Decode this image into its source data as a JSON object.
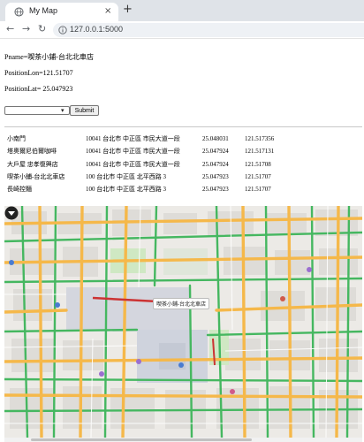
{
  "browser": {
    "tab_title": "My Map",
    "tab_close": "×",
    "new_tab": "+",
    "url": "127.0.0.1:5000",
    "nav": {
      "back": "←",
      "forward": "→",
      "reload": "↻"
    }
  },
  "info": {
    "pname": "Pname=喫茶小鋪-台北北車店",
    "lon": "PositionLon=121.51707",
    "lat": "PositionLat= 25.047923"
  },
  "form": {
    "select_value": "",
    "caret": "▾",
    "submit_label": "Submit"
  },
  "places": [
    {
      "name": "小南門",
      "address": "10041 台北市 中正區 市民大道一段",
      "lat": "25.048031",
      "lon": "121.517356"
    },
    {
      "name": "塔奧爾尼伯爾咖啡",
      "address": "10041 台北市 中正區 市民大道一段",
      "lat": "25.047924",
      "lon": "121.517131"
    },
    {
      "name": "大戶屋 忠孝復興店",
      "address": "10041 台北市 中正區 市民大道一段",
      "lat": "25.047924",
      "lon": "121.51708"
    },
    {
      "name": "喫茶小鋪-台北北車店",
      "address": "100 台北市 中正區 北平西路 3",
      "lat": "25.047923",
      "lon": "121.51707"
    },
    {
      "name": "長崎控麵",
      "address": "100 台北市 中正區 北平西路 3",
      "lat": "25.047923",
      "lon": "121.51707"
    }
  ],
  "map": {
    "popup": "喫茶小鋪-台北北車店",
    "colors": {
      "major_road": "#f5b84a",
      "green_road": "#45b760",
      "park": "#cfe8c3",
      "block": "#dedcd8",
      "marker": "#222222"
    }
  }
}
